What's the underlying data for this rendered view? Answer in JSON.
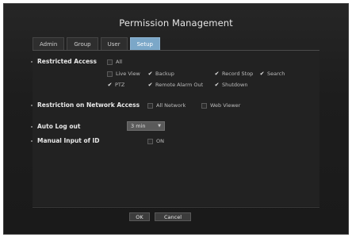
{
  "dialog": {
    "title": "Permission Management"
  },
  "tabs": [
    {
      "label": "Admin",
      "active": false
    },
    {
      "label": "Group",
      "active": false
    },
    {
      "label": "User",
      "active": false
    },
    {
      "label": "Setup",
      "active": true
    }
  ],
  "restricted_access": {
    "label": "Restricted Access",
    "all": {
      "label": "All",
      "checked": false
    },
    "live_view": {
      "label": "Live View",
      "checked": false
    },
    "backup": {
      "label": "Backup",
      "checked": true
    },
    "record_stop": {
      "label": "Record Stop",
      "checked": true
    },
    "search": {
      "label": "Search",
      "checked": true
    },
    "ptz": {
      "label": "PTZ",
      "checked": true
    },
    "remote_alarm_out": {
      "label": "Remote Alarm Out",
      "checked": true
    },
    "shutdown": {
      "label": "Shutdown",
      "checked": true
    }
  },
  "network_access": {
    "label": "Restriction on Network Access",
    "all_network": {
      "label": "All Network",
      "checked": false
    },
    "web_viewer": {
      "label": "Web Viewer",
      "checked": false
    }
  },
  "auto_logout": {
    "label": "Auto Log out",
    "value": "3 min"
  },
  "manual_input": {
    "label": "Manual Input of ID",
    "option": {
      "label": "ON",
      "checked": false
    }
  },
  "buttons": {
    "ok": "OK",
    "cancel": "Cancel"
  },
  "colors": {
    "active_tab": "#7ba7c8",
    "background": "#1d1d1d"
  }
}
